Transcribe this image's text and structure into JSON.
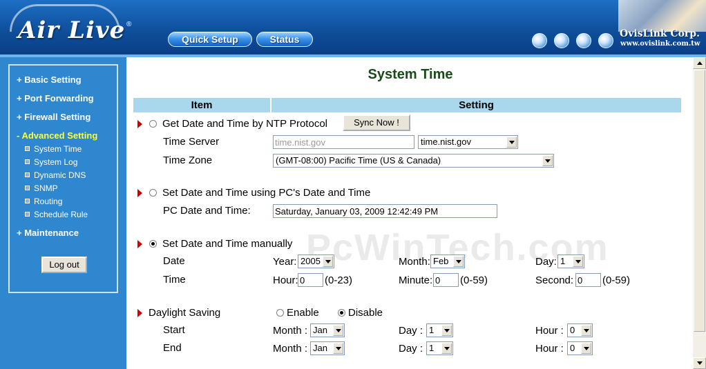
{
  "header": {
    "logo": "Air Live",
    "logo_mark": "®",
    "nav": {
      "quick_setup": "Quick Setup",
      "status": "Status"
    },
    "company": "OvisLink Corp.",
    "company_url": "www.ovislink.com.tw"
  },
  "sidebar": {
    "items": [
      {
        "label": "+ Basic Setting"
      },
      {
        "label": "+ Port Forwarding"
      },
      {
        "label": "+ Firewall Setting"
      },
      {
        "label": "- Advanced Setting"
      },
      {
        "label": "+ Maintenance"
      }
    ],
    "subitems": [
      {
        "label": "System Time"
      },
      {
        "label": "System Log"
      },
      {
        "label": "Dynamic DNS"
      },
      {
        "label": "SNMP"
      },
      {
        "label": "Routing"
      },
      {
        "label": "Schedule Rule"
      }
    ],
    "logout": "Log out"
  },
  "main": {
    "title": "System Time",
    "headers": {
      "item": "Item",
      "setting": "Setting"
    },
    "ntp": {
      "label": "Get Date and Time by NTP Protocol",
      "sync_button": "Sync Now !",
      "server_label": "Time Server",
      "server_input": "time.nist.gov",
      "server_select": "time.nist.gov",
      "zone_label": "Time Zone",
      "zone_select": "(GMT-08:00) Pacific Time (US & Canada)"
    },
    "pc": {
      "label": "Set Date and Time using PC's Date and Time",
      "field_label": "PC Date and Time:",
      "value": "Saturday, January 03, 2009 12:42:49 PM"
    },
    "manual": {
      "label": "Set Date and Time manually",
      "date_label": "Date",
      "time_label": "Time",
      "year_label": "Year:",
      "year": "2005",
      "month_label": "Month:",
      "month": "Feb",
      "day_label": "Day:",
      "day": "1",
      "hour_label": "Hour:",
      "hour": "0",
      "hour_range": "(0-23)",
      "minute_label": "Minute:",
      "minute": "0",
      "minute_range": "(0-59)",
      "second_label": "Second:",
      "second": "0",
      "second_range": "(0-59)"
    },
    "dst": {
      "label": "Daylight Saving",
      "enable": "Enable",
      "disable": "Disable",
      "start_label": "Start",
      "end_label": "End",
      "month_label": "Month :",
      "day_label": "Day :",
      "hour_label": "Hour :",
      "start_month": "Jan",
      "start_day": "1",
      "start_hour": "0",
      "end_month": "Jan",
      "end_day": "1",
      "end_hour": "0"
    },
    "watermark": "PcWinTech.com"
  },
  "colors": {
    "header_blue": "#0f4f9c",
    "sidebar_blue": "#2f87cf",
    "table_header": "#a9d8ec",
    "active_menu": "#ffff33",
    "title_green": "#1a4a1a",
    "arrow_red": "#cc0000"
  }
}
